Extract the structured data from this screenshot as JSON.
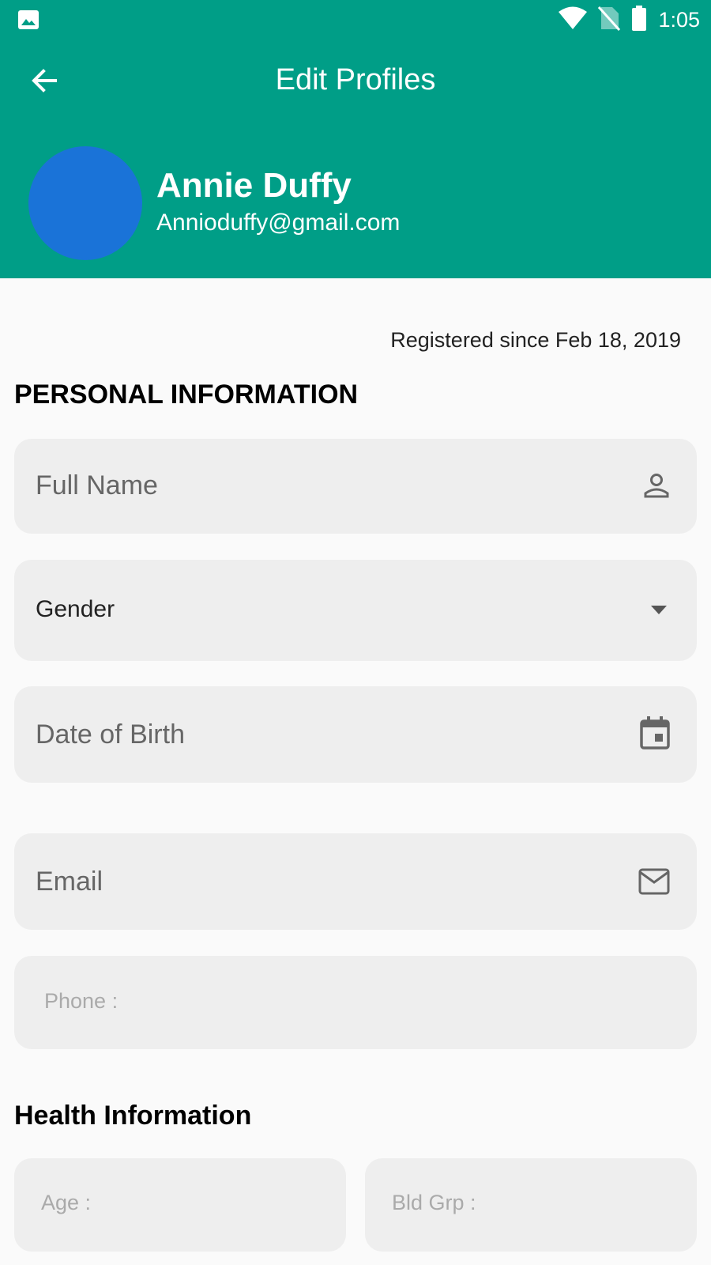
{
  "status_bar": {
    "time": "1:05",
    "icons": [
      "image-icon",
      "wifi-icon",
      "no-sim-icon",
      "battery-icon"
    ]
  },
  "header": {
    "title": "Edit Profiles",
    "back_icon": "arrow-back-icon",
    "user_name": "Annie Duffy",
    "user_email": "Annioduffy@gmail.com",
    "avatar_color": "#1a73d8",
    "background_color": "#009e87"
  },
  "registered": "Registered since Feb 18, 2019",
  "personal": {
    "title": "PERSONAL INFORMATION",
    "full_name_placeholder": "Full Name",
    "gender_label": "Gender",
    "dob_placeholder": "Date of Birth",
    "email_placeholder": "Email",
    "phone_placeholder": "Phone :"
  },
  "health": {
    "title": "Health Information",
    "age_placeholder": "Age :",
    "blood_group_placeholder": "Bld Grp :"
  }
}
